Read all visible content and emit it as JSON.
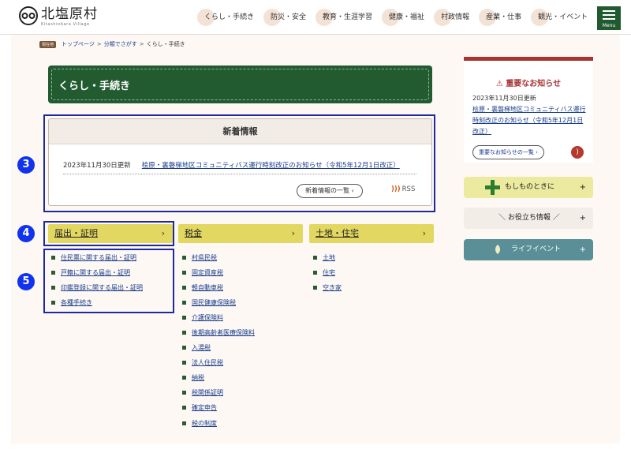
{
  "header": {
    "logo_text": "北塩原村",
    "logo_sub": "Kitashiobara Village",
    "nav": [
      "くらし・手続き",
      "防災・安全",
      "教育・生涯学習",
      "健康・福祉",
      "村政情報",
      "産業・仕事",
      "観光・イベント"
    ],
    "menu_label": "Menu"
  },
  "breadcrumb": {
    "home_badge": "現在地",
    "items": [
      "トップページ",
      "分類でさがす"
    ],
    "separator": ">",
    "current": "くらし・手続き"
  },
  "page_title": "くらし・手続き",
  "news": {
    "heading": "新着情報",
    "items": [
      {
        "date": "2023年11月30日更新",
        "title": "桧原・裏磐梯地区コミュニティバス運行時刻改正のお知らせ（令和5年12月1日改正）"
      }
    ],
    "more_label": "新着情報の一覧",
    "rss_label": "RSS"
  },
  "categories": [
    {
      "title": "届出・証明",
      "items": [
        "住民票に関する届出・証明",
        "戸籍に関する届出・証明",
        "印鑑登録に関する届出・証明",
        "各種手続き"
      ]
    },
    {
      "title": "税金",
      "items": [
        "村県民税",
        "固定資産税",
        "軽自動車税",
        "国民健康保険税",
        "介護保険料",
        "後期高齢者医療保険料",
        "入湯税",
        "法人住民税",
        "納税",
        "税関係証明",
        "確定申告",
        "税の制度"
      ]
    },
    {
      "title": "土地・住宅",
      "items": [
        "土地",
        "住宅",
        "空き家"
      ]
    }
  ],
  "annotations": {
    "news": "3",
    "category": "4",
    "list": "5"
  },
  "alert": {
    "title": "重要なお知らせ",
    "date": "2023年11月30日更新",
    "link": "桧原・裏磐梯地区コミュニティバス運行時刻改正のお知らせ（令和5年12月1日改正）",
    "list_label": "重要なお知らせの一覧"
  },
  "side_buttons": {
    "emergency": "もしものときに",
    "useful": "＼ お役立ち情報 ／",
    "life": "ライフイベント",
    "plus": "+"
  },
  "colors": {
    "brand_green": "#225b30",
    "alert_red": "#a83333",
    "category_yellow": "#e2d761",
    "annotation_blue": "#1133ee"
  }
}
